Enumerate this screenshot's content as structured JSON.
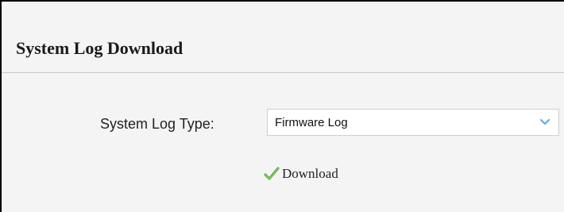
{
  "panel": {
    "title": "System Log Download"
  },
  "form": {
    "log_type_label": "System Log Type:",
    "log_type_selected": "Firmware Log"
  },
  "actions": {
    "download_label": "Download"
  },
  "icons": {
    "dropdown": "chevron-down-icon",
    "download": "checkmark-icon"
  },
  "colors": {
    "chevron": "#5aa9e6",
    "checkmark": "#6cc04a",
    "header_background": "#f4f4f4"
  }
}
